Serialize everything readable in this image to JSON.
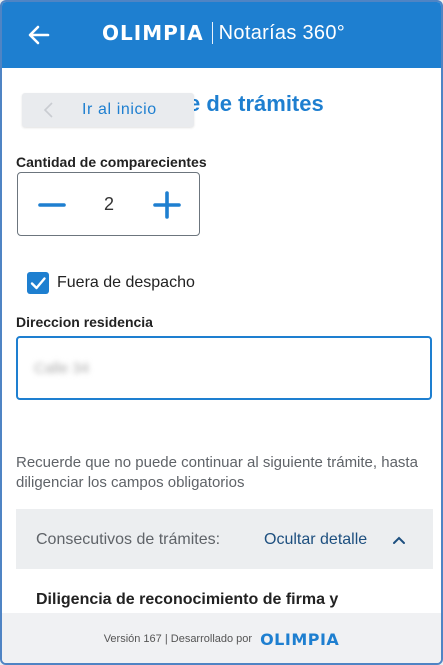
{
  "header": {
    "brand_logo": "OLIMPIA",
    "brand_subtitle": "Notarías 360°"
  },
  "page": {
    "title_fragment": "e de trámites",
    "home_button_label": "Ir al inicio"
  },
  "form": {
    "comparecientes_label": "Cantidad de comparecientes",
    "comparecientes_value": "2",
    "fuera_despacho_label": "Fuera de despacho",
    "fuera_despacho_checked": true,
    "direccion_label": "Direccion residencia",
    "direccion_value": "Calle 34"
  },
  "notice": "Recuerde que no puede continuar al siguiente trámite, hasta diligenciar los campos obligatorios",
  "consecutivos": {
    "label": "Consecutivos de trámites:",
    "toggle_label": "Ocultar detalle"
  },
  "tramite_item": "Diligencia de reconocimiento de firma y",
  "footer": {
    "text": "Versión 167 | Desarrollado por",
    "logo": "OLIMPIA"
  },
  "colors": {
    "primary": "#1e7fd0",
    "text_dark": "#222222",
    "text_muted": "#5f6368",
    "panel_bg": "#eceef0"
  }
}
